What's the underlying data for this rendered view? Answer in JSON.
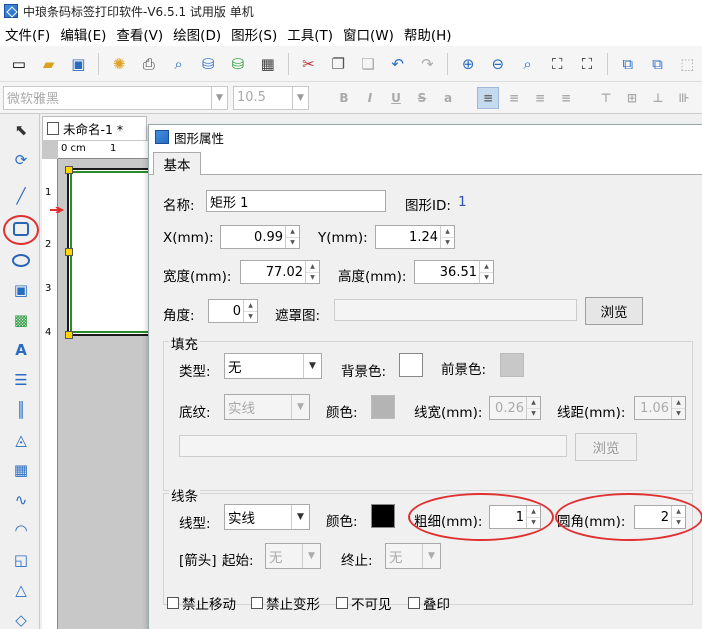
{
  "app": {
    "title": "中琅条码标签打印软件-V6.5.1 试用版 单机"
  },
  "menu": [
    "文件(F)",
    "编辑(E)",
    "查看(V)",
    "绘图(D)",
    "图形(S)",
    "工具(T)",
    "窗口(W)",
    "帮助(H)"
  ],
  "format": {
    "font": "微软雅黑",
    "size": "10.5"
  },
  "document": {
    "tab_label": "未命名-1 *",
    "ruler_top_label": "0 cm",
    "ruler_top_mark": "1",
    "ruler_left_labels": [
      "1",
      "2",
      "3",
      "4"
    ]
  },
  "dialog": {
    "title": "图形属性",
    "tab": "基本",
    "name_label": "名称:",
    "name_value": "矩形 1",
    "id_label": "图形ID:",
    "id_value": "1",
    "x_label": "X(mm):",
    "x_value": "0.99",
    "y_label": "Y(mm):",
    "y_value": "1.24",
    "width_label": "宽度(mm):",
    "width_value": "77.02",
    "height_label": "高度(mm):",
    "height_value": "36.51",
    "angle_label": "角度:",
    "angle_value": "0",
    "mask_label": "遮罩图:",
    "browse": "浏览",
    "fill": {
      "title": "填充",
      "type_label": "类型:",
      "type_value": "无",
      "bg_label": "背景色:",
      "fg_label": "前景色:",
      "pattern_label": "底纹:",
      "pattern_value": "实线",
      "color_label": "颜色:",
      "linewidth_label": "线宽(mm):",
      "linewidth_value": "0.26",
      "spacing_label": "线距(mm):",
      "spacing_value": "1.06",
      "browse": "浏览"
    },
    "line": {
      "title": "线条",
      "type_label": "线型:",
      "type_value": "实线",
      "color_label": "颜色:",
      "thickness_label": "粗细(mm):",
      "thickness_value": "1",
      "corner_label": "圆角(mm):",
      "corner_value": "2",
      "arrow_label": "[箭头]",
      "start_label": "起始:",
      "start_value": "无",
      "end_label": "终止:",
      "end_value": "无"
    },
    "checks": [
      "禁止移动",
      "禁止变形",
      "不可见",
      "叠印"
    ]
  },
  "colors": {
    "fill_bg": "#ffffff",
    "fill_fg": "#c8c8c8",
    "pattern_color": "#b4b4b4",
    "line_color": "#000000",
    "highlight": "#e03030",
    "accent": "#2a6cc2"
  }
}
